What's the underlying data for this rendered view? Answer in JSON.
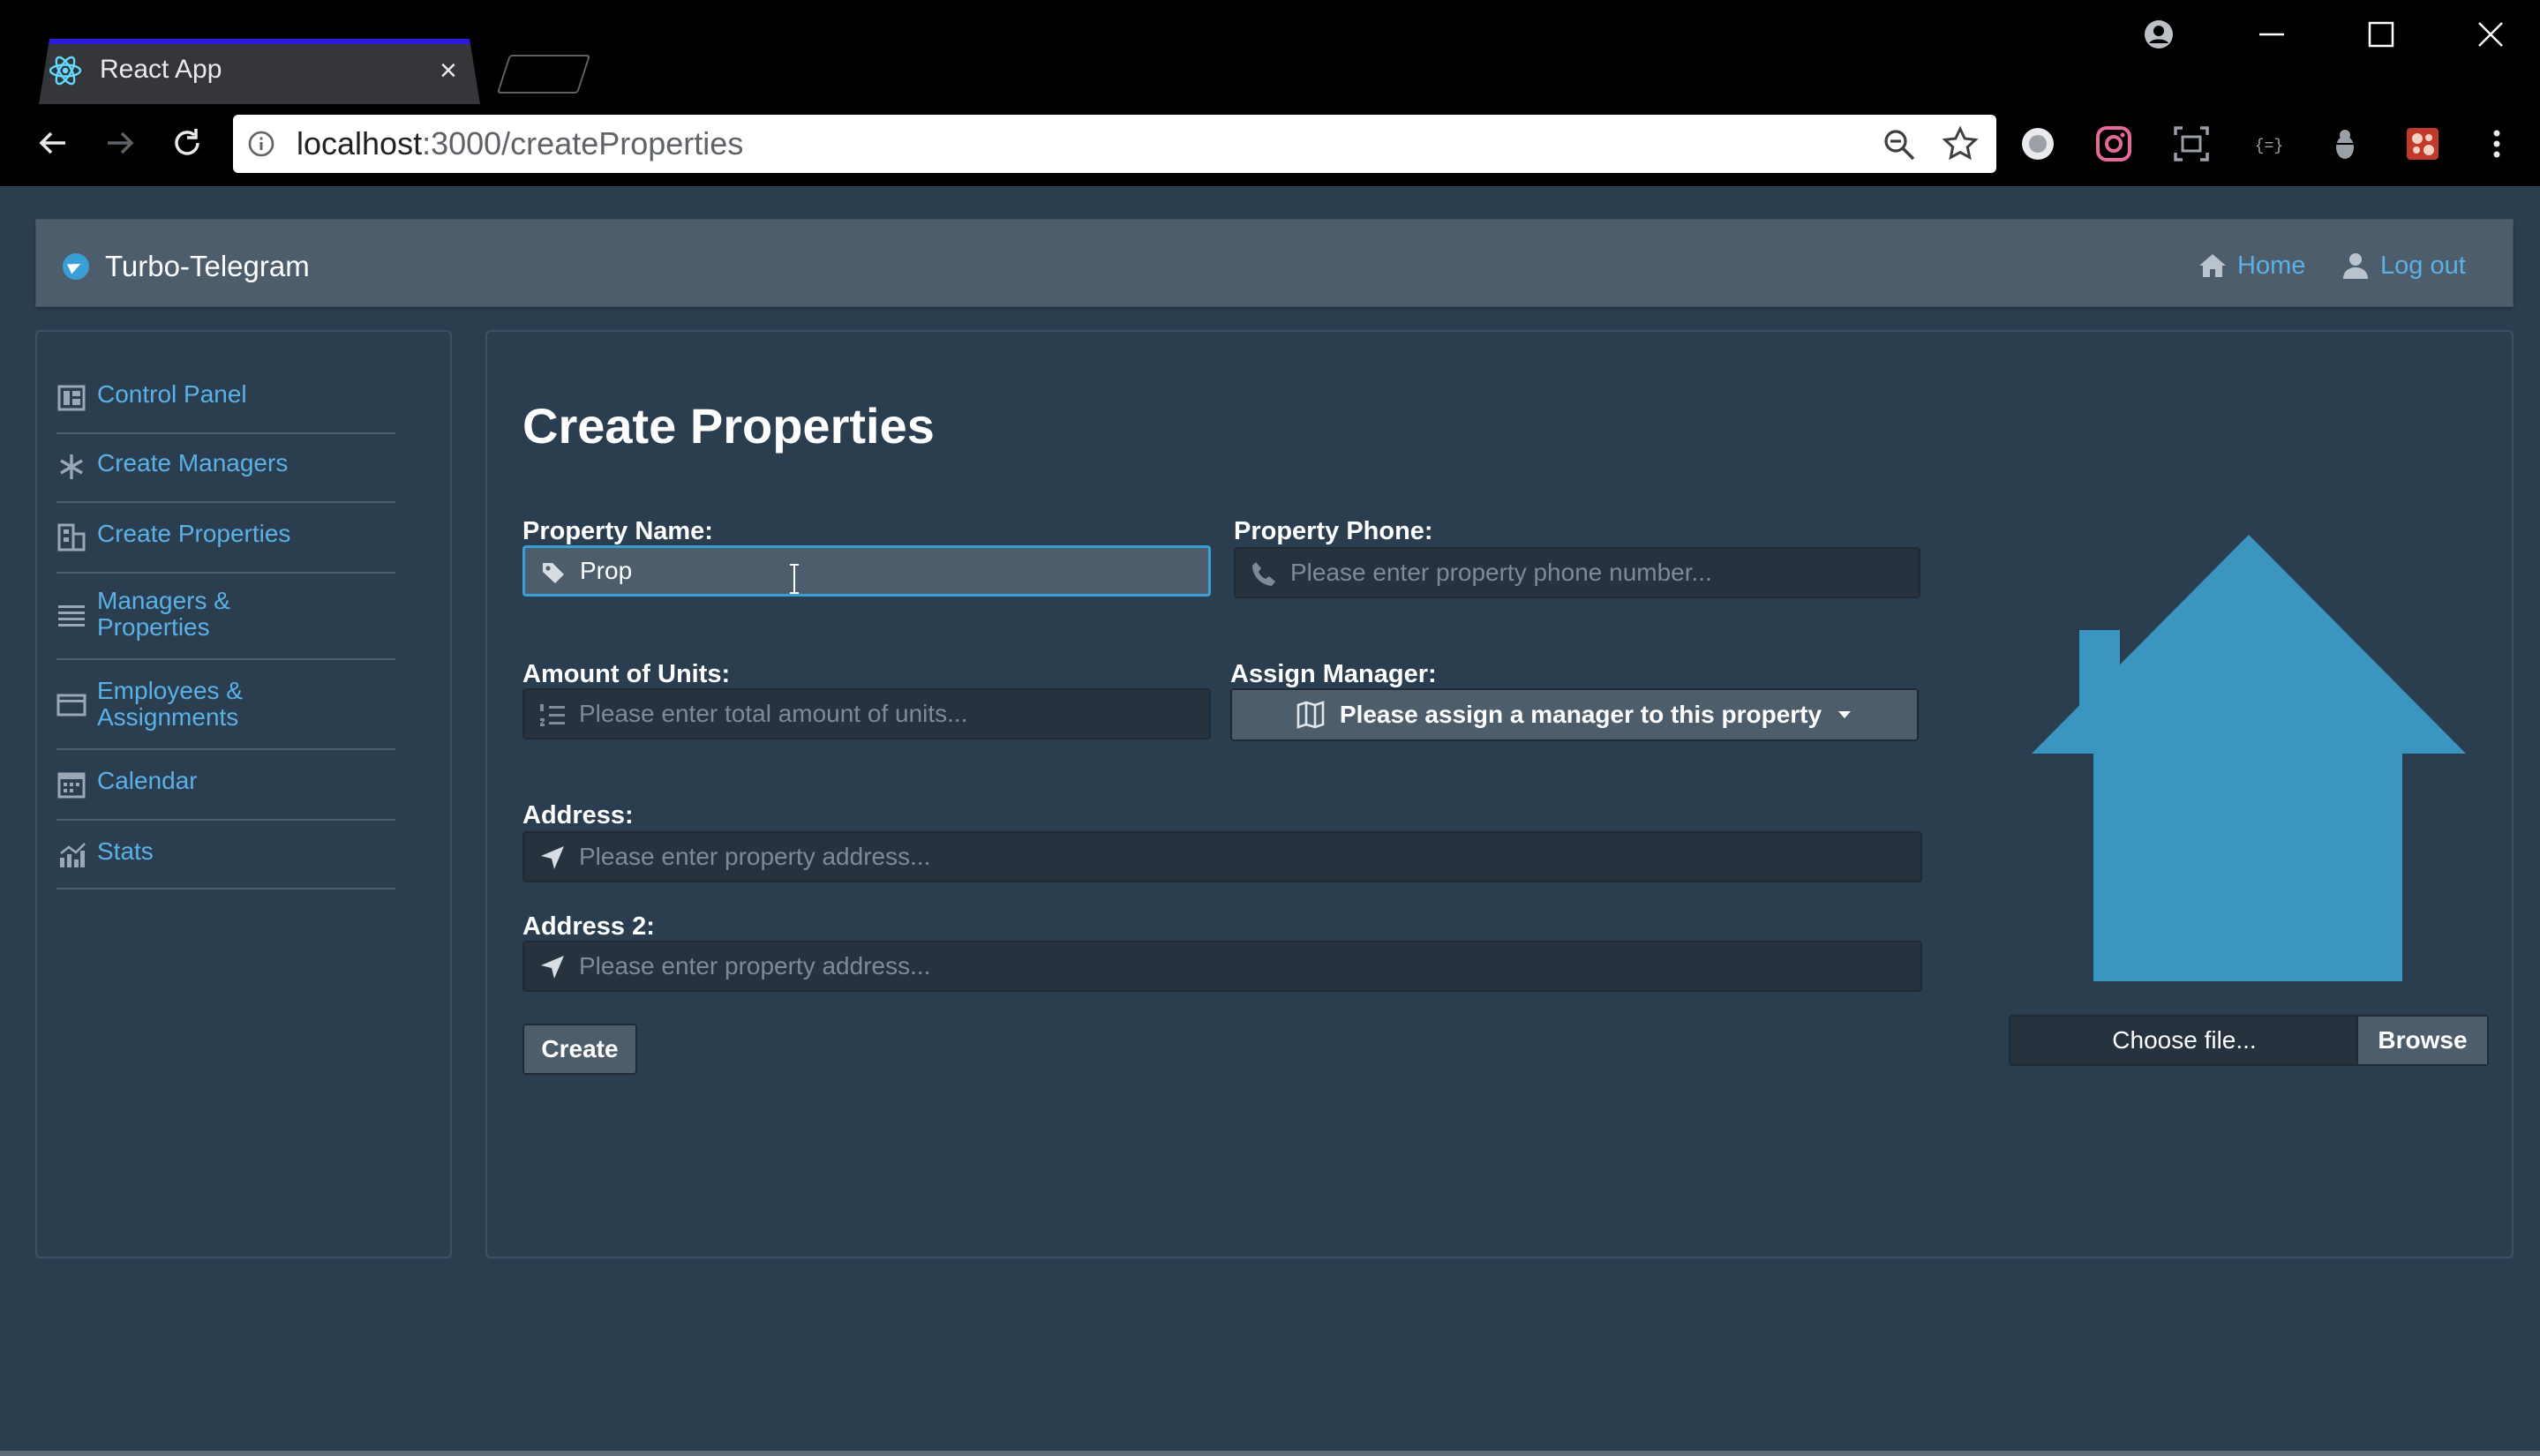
{
  "browser": {
    "tab_title": "React App",
    "tab_close": "×",
    "url_host": "localhost",
    "url_path": ":3000/createProperties"
  },
  "colors": {
    "page_bg": "#2b3e50",
    "navbar_bg": "#4e5d6c",
    "accent": "#3a9fd5",
    "link": "#5bb1e6",
    "house": "#3b95c1"
  },
  "navbar": {
    "brand": "Turbo-Telegram",
    "home_label": "Home",
    "logout_label": "Log out"
  },
  "sidebar": {
    "items": [
      {
        "label": "Control Panel",
        "icon": "dashboard-icon"
      },
      {
        "label": "Create Managers",
        "icon": "asterisk-icon"
      },
      {
        "label": "Create Properties",
        "icon": "building-icon"
      },
      {
        "label": "Managers & Properties",
        "icon": "list-icon"
      },
      {
        "label": "Employees & Assignments",
        "icon": "id-card-icon"
      },
      {
        "label": "Calendar",
        "icon": "calendar-icon"
      },
      {
        "label": "Stats",
        "icon": "chart-icon"
      }
    ]
  },
  "form": {
    "title": "Create Properties",
    "property_name": {
      "label": "Property Name:",
      "value": "Prop"
    },
    "property_phone": {
      "label": "Property Phone:",
      "placeholder": "Please enter property phone number..."
    },
    "units": {
      "label": "Amount of Units:",
      "placeholder": "Please enter total amount of units..."
    },
    "manager": {
      "label": "Assign Manager:",
      "selected": "Please assign a manager to this property"
    },
    "address": {
      "label": "Address:",
      "placeholder": "Please enter property address..."
    },
    "address2": {
      "label": "Address 2:",
      "placeholder": "Please enter property address..."
    },
    "create_label": "Create",
    "file_text": "Choose file...",
    "browse_label": "Browse"
  }
}
